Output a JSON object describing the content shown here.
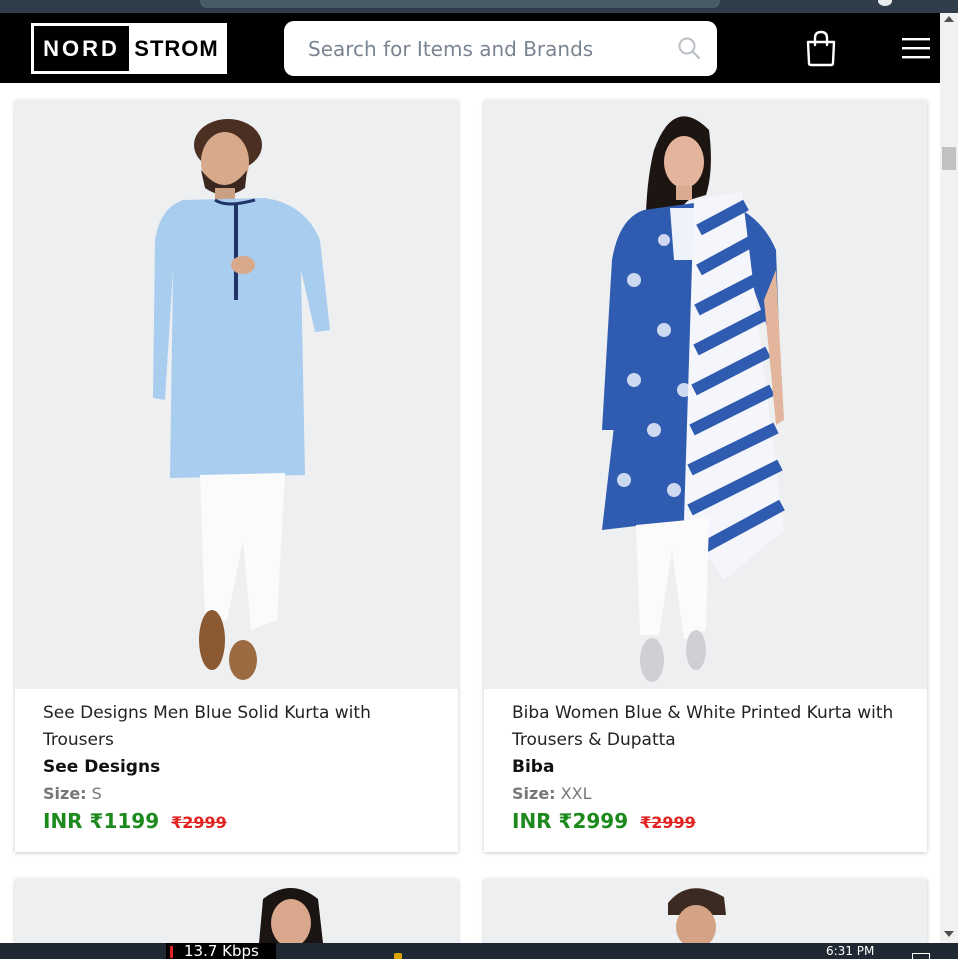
{
  "header": {
    "logo_left": "NORD",
    "logo_right": "STROM",
    "search_placeholder": "Search for Items and Brands",
    "icons": [
      "search-icon",
      "shopping-bag-icon",
      "hamburger-menu-icon"
    ]
  },
  "products": [
    {
      "title": "See Designs Men Blue Solid Kurta with Trousers",
      "brand": "See Designs",
      "size_label": "Size:",
      "size_value": "S",
      "price": "INR ₹1199",
      "mrp": "₹2999"
    },
    {
      "title": "Biba Women Blue & White Printed Kurta with Trousers & Dupatta",
      "brand": "Biba",
      "size_label": "Size:",
      "size_value": "XXL",
      "price": "INR ₹2999",
      "mrp": "₹2999"
    }
  ],
  "taskbar": {
    "network_speed": "13.7 Kbps",
    "time": "6:31 PM"
  },
  "colors": {
    "header_bg": "#000000",
    "price_green": "#1d8a1d",
    "mrp_red": "#e22121",
    "photo_bg": "#eeeff1"
  }
}
